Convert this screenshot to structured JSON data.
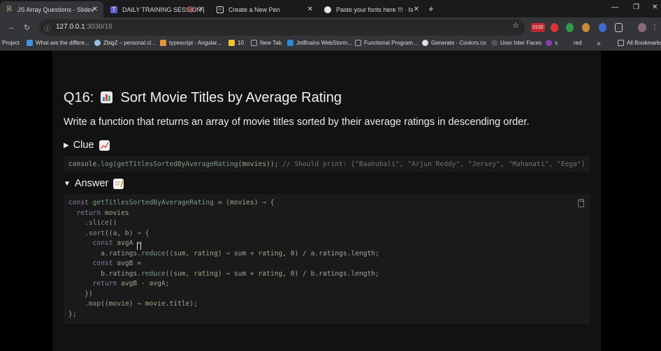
{
  "tabs": [
    {
      "title": "JS Array Questions - Slidev",
      "favicon": "slidev-icon",
      "active": true
    },
    {
      "title": "DAILY TRAINING SESSION |",
      "favicon": "teams-icon",
      "active": false
    },
    {
      "title": "Create a New Pen",
      "favicon": "codepen-icon",
      "active": false
    },
    {
      "title": "Paste your fonts here !!! · Issue",
      "favicon": "github-icon",
      "active": false
    }
  ],
  "address_bar": {
    "host": "127.0.0.1",
    "path": ":3030/16"
  },
  "extensions": {
    "badge": "0132"
  },
  "bookmarks": [
    {
      "label": "Project"
    },
    {
      "label": "What are the differe..."
    },
    {
      "label": "ZbigZ – personal cl..."
    },
    {
      "label": "typescript - Angular..."
    },
    {
      "label": "10"
    },
    {
      "label": "New Tab"
    },
    {
      "label": "JetBrains WebStorm..."
    },
    {
      "label": "Functional Program..."
    },
    {
      "label": "Generate - Coolors.co"
    },
    {
      "label": "User Inter Faces"
    },
    {
      "label": "s"
    },
    {
      "label": "red"
    },
    {
      "label": "All Bookmarks"
    }
  ],
  "slide": {
    "title_prefix": "Q16:",
    "title_text": "Sort Movie Titles by Average Rating",
    "description": "Write a function that returns an array of movie titles sorted by their average ratings in descending order.",
    "clue_label": "Clue",
    "answer_label": "Answer",
    "clue_code": "console.log(getTitlesSortedByAverageRating(movies)); // Should print: [\"Baahubali\", \"Arjun Reddy\", \"Jersey\", \"Mahanati\", \"Eega\"]",
    "answer_code": [
      "const getTitlesSortedByAverageRating = (movies) ⇒ {",
      "  return movies",
      "    .slice()",
      "    .sort((a, b) ⇒ {",
      "      const avgA =",
      "        a.ratings.reduce((sum, rating) ⇒ sum + rating, 0) / a.ratings.length;",
      "      const avgB =",
      "        b.ratings.reduce((sum, rating) ⇒ sum + rating, 0) / b.ratings.length;",
      "      return avgB - avgA;",
      "    })",
      "    .map((movie) ⇒ movie.title);",
      "};"
    ]
  },
  "colors": {
    "page": "#000000",
    "slide": "#121212",
    "code_bg": "#1a1a1a",
    "chrome_toolbar": "#343538",
    "tab_strip": "#1b1b1d"
  }
}
